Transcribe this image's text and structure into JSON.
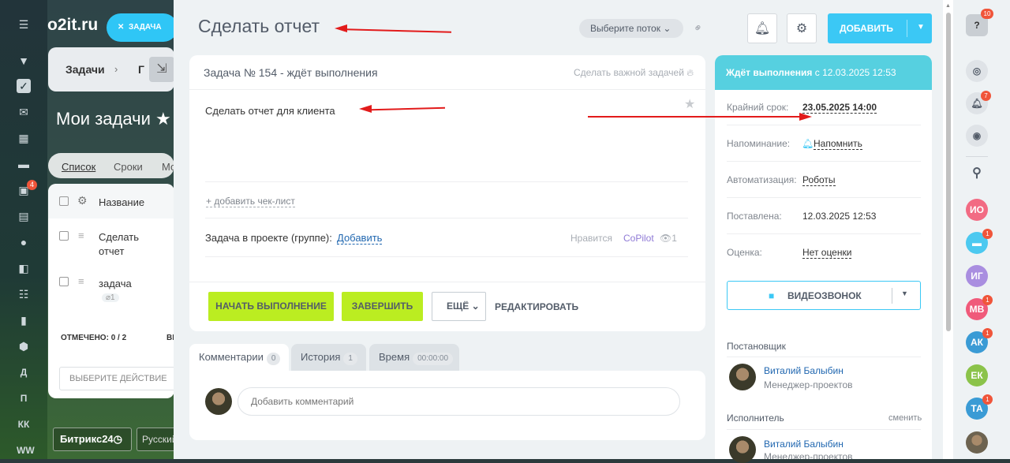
{
  "portal": {
    "logo": "o2it.ru",
    "task_button": "ЗАДАЧА",
    "breadcrumb_tasks": "Задачи",
    "breadcrumb_next": "Г",
    "my_tasks_title": "Мои задачи",
    "view_tabs": [
      "Список",
      "Сроки",
      "Мо"
    ],
    "column_name": "Название",
    "rows": [
      {
        "title": "Сделать отчет"
      },
      {
        "title": "задача",
        "attach_count": "1"
      }
    ],
    "selected_label": "ОТМЕЧЕНО: 0 / 2",
    "selected_trunc": "ВЫ",
    "action_select": "ВЫБЕРИТЕ ДЕЙСТВИЕ",
    "bottom_brand": "Битрикс24",
    "bottom_lang": "Русский",
    "left_badges": {
      "mail": "4"
    },
    "left_letters": [
      "Д",
      "П",
      "КК",
      "WW"
    ]
  },
  "task": {
    "title": "Сделать отчет",
    "flow_select": "Выберите поток",
    "add_button": "ДОБАВИТЬ",
    "header": "Задача № 154 - ждёт выполнения",
    "make_important": "Сделать важной задачей",
    "description": "Сделать отчет для клиента",
    "add_checklist": "+ добавить чек-лист",
    "project_label": "Задача в проекте (группе):",
    "project_add": "Добавить",
    "like": "Нравится",
    "copilot": "CoPilot",
    "views": "1",
    "start_button": "НАЧАТЬ ВЫПОЛНЕНИЕ",
    "finish_button": "ЗАВЕРШИТЬ",
    "more_button": "ЕЩЁ",
    "edit_button": "РЕДАКТИРОВАТЬ"
  },
  "comments": {
    "tabs": [
      {
        "label": "Комментарии",
        "count": "0"
      },
      {
        "label": "История",
        "count": "1"
      },
      {
        "label": "Время",
        "count": "00:00:00"
      }
    ],
    "placeholder": "Добавить комментарий"
  },
  "sidebar": {
    "status_prefix": "Ждёт выполнения",
    "status_suffix": "с 12.03.2025 12:53",
    "deadline_label": "Крайний срок:",
    "deadline_value": "23.05.2025 14:00",
    "reminder_label": "Напоминание:",
    "reminder_value": "Напомнить",
    "automation_label": "Автоматизация:",
    "automation_value": "Роботы",
    "created_label": "Поставлена:",
    "created_value": "12.03.2025 12:53",
    "rating_label": "Оценка:",
    "rating_value": "Нет оценки",
    "video_call": "ВИДЕОЗВОНОК",
    "creator_label": "Постановщик",
    "creator_name": "Виталий Балыбин",
    "creator_role": "Менеджер-проектов",
    "assignee_label": "Исполнитель",
    "assignee_change": "сменить",
    "assignee_name": "Виталий Балыбин",
    "assignee_role": "Менеджер-проектов"
  },
  "right_bar": {
    "help_badge": "10",
    "bell_badge": "7",
    "avatars": [
      {
        "initials": "ИО",
        "color": "#f26b83",
        "badge": ""
      },
      {
        "initials": "",
        "color": "#4cc9f0",
        "badge": "1"
      },
      {
        "initials": "ИГ",
        "color": "#a98ee0",
        "badge": ""
      },
      {
        "initials": "МВ",
        "color": "#f05a7a",
        "badge": "1"
      },
      {
        "initials": "АК",
        "color": "#3a9bd5",
        "badge": "1"
      },
      {
        "initials": "ЕК",
        "color": "#8bc34a",
        "badge": ""
      },
      {
        "initials": "ТА",
        "color": "#3a9bd5",
        "badge": "1"
      }
    ]
  }
}
